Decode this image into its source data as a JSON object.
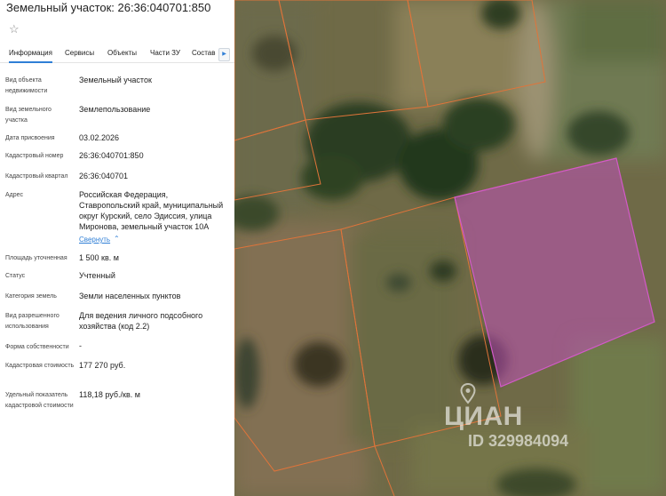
{
  "header": {
    "title": "Земельный участок: 26:36:040701:850",
    "favorite_icon": "star-icon"
  },
  "tabs": [
    {
      "label": "Информация",
      "active": true
    },
    {
      "label": "Сервисы",
      "active": false
    },
    {
      "label": "Объекты",
      "active": false
    },
    {
      "label": "Части ЗУ",
      "active": false
    },
    {
      "label": "Состав",
      "active": false
    }
  ],
  "tabs_scroll_icon": "chevron-right-icon",
  "fields": {
    "object_type": {
      "label": "Вид объекта недвижимости",
      "value": "Земельный участок"
    },
    "land_type": {
      "label": "Вид земельного участка",
      "value": "Землепользование"
    },
    "assign_date": {
      "label": "Дата присвоения",
      "value": "03.02.2026"
    },
    "cadastral_number": {
      "label": "Кадастровый номер",
      "value": "26:36:040701:850"
    },
    "cadastral_quarter": {
      "label": "Кадастровый квартал",
      "value": "26:36:040701"
    },
    "address": {
      "label": "Адрес",
      "value_lines": [
        "Российская Федерация,",
        "Ставропольский край, муниципальный",
        "округ Курский, село Эдиссия, улица",
        "Миронова, земельный участок 10А"
      ],
      "collapse_link": "Свернуть"
    },
    "area": {
      "label": "Площадь уточненная",
      "value": "1 500 кв. м"
    },
    "status": {
      "label": "Статус",
      "value": "Учтенный"
    },
    "land_category": {
      "label": "Категория земель",
      "value": "Земли населенных пунктов"
    },
    "permitted_use": {
      "label": "Вид разрешенного использования",
      "value_lines": [
        "Для ведения личного подсобного",
        "хозяйства (код 2.2)"
      ]
    },
    "ownership": {
      "label": "Форма собственности",
      "value": "-"
    },
    "cadastral_value": {
      "label": "Кадастровая стоимость",
      "value": "177 270 руб."
    },
    "specific_value": {
      "label": "Удельный показатель кадастровой стоимости",
      "value": "118,18 руб./кв. м"
    }
  },
  "watermark": {
    "logo": "ЦИАН",
    "id": "ID 329984094",
    "icon": "location-pin-icon"
  },
  "colors": {
    "accent": "#2f7fd6",
    "parcel_border": "#e0743a",
    "selected_parcel_fill": "#c050b8"
  }
}
